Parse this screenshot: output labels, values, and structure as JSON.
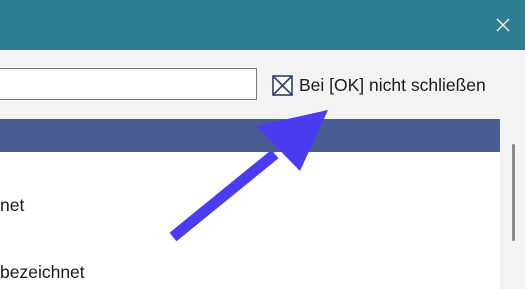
{
  "window": {
    "close_icon": "close-icon",
    "titlebar_color": "#2f7f93"
  },
  "toolbar": {
    "search_value": "",
    "keep_open_checkbox": {
      "label": "Bei [OK] nicht schließen",
      "checked": true
    }
  },
  "list": {
    "header_color": "#4a5d92",
    "items": [
      {
        "label": "net"
      },
      {
        "label": "bezeichnet"
      }
    ]
  },
  "annotation": {
    "arrow_color": "#4a3cf0"
  }
}
